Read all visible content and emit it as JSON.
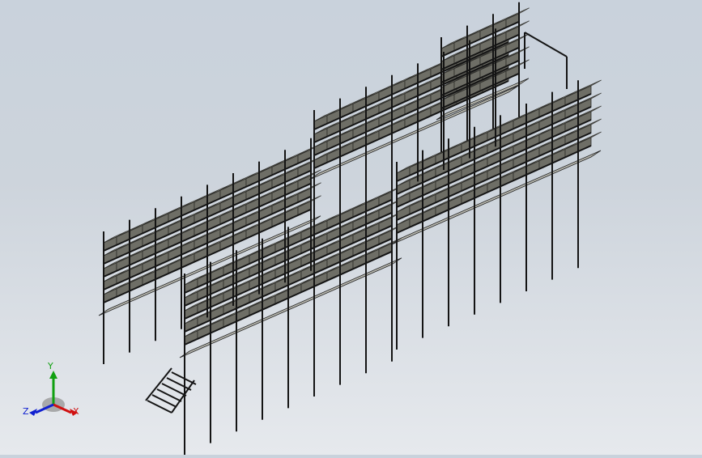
{
  "scene": {
    "background_top": "#c9d2dc",
    "background_bottom": "#e6e9ed",
    "frame_color": "#141414",
    "bin_color": "#8f8f86",
    "bin_dark": "#6e6e66",
    "deck_color": "#b9b9b0"
  },
  "triad": {
    "x_label": "X",
    "y_label": "Y",
    "z_label": "Z",
    "x_color": "#d01010",
    "y_color": "#10a010",
    "z_color": "#1020d0"
  }
}
